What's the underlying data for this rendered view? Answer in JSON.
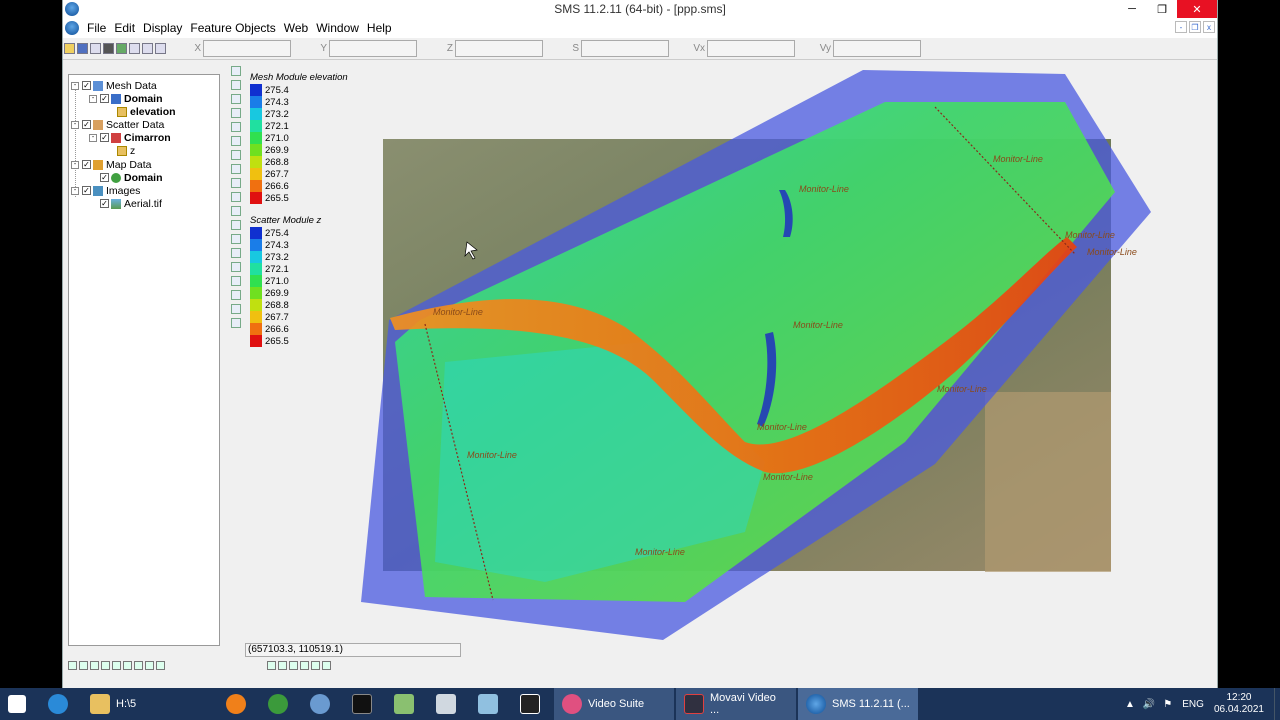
{
  "window": {
    "title": "SMS 11.2.11 (64-bit) - [ppp.sms]",
    "controls": {
      "minimize": "─",
      "maximize": "❐",
      "close": "✕"
    }
  },
  "menu": [
    "File",
    "Edit",
    "Display",
    "Feature Objects",
    "Web",
    "Window",
    "Help"
  ],
  "mdi_controls": [
    "-",
    "❐",
    "x"
  ],
  "coords": [
    {
      "label": "X"
    },
    {
      "label": "Y"
    },
    {
      "label": "Z"
    },
    {
      "label": "S"
    },
    {
      "label": "Vx"
    },
    {
      "label": "Vy"
    }
  ],
  "tree": {
    "mesh_data": "Mesh Data",
    "mesh_domain": "Domain",
    "mesh_elevation": "elevation",
    "scatter_data": "Scatter Data",
    "scatter_cimarron": "Cimarron",
    "scatter_z": "z",
    "map_data": "Map Data",
    "map_domain": "Domain",
    "images": "Images",
    "aerial": "Aerial.tif"
  },
  "legend_mesh": {
    "title": "Mesh Module elevation",
    "values": [
      "275.4",
      "274.3",
      "273.2",
      "272.1",
      "271.0",
      "269.9",
      "268.8",
      "267.7",
      "266.6",
      "265.5"
    ],
    "colors": [
      "#1030d0",
      "#1a7de8",
      "#18c8e0",
      "#20e0a0",
      "#30e050",
      "#70e020",
      "#c0e010",
      "#f0c010",
      "#f07010",
      "#e01010"
    ]
  },
  "legend_scatter": {
    "title": "Scatter Module z",
    "values": [
      "275.4",
      "274.3",
      "273.2",
      "272.1",
      "271.0",
      "269.9",
      "268.8",
      "267.7",
      "266.6",
      "265.5"
    ]
  },
  "map_labels": {
    "monitor_line": "Monitor-Line"
  },
  "status": {
    "coordinates": "(657103.3, 110519.1)"
  },
  "taskbar": {
    "folder_label": "H:\\5",
    "video_suite": "Video Suite",
    "movavi": "Movavi Video ...",
    "sms": "SMS 11.2.11 (...",
    "language": "ENG",
    "time": "12:20",
    "date": "06.04.2021"
  }
}
